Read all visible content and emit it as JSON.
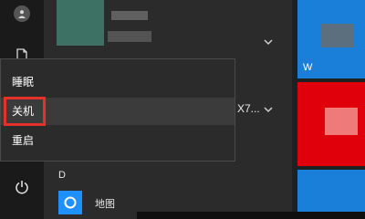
{
  "power_menu": {
    "items": [
      {
        "label": "睡眠"
      },
      {
        "label": "关机"
      },
      {
        "label": "重启"
      }
    ]
  },
  "app_list": {
    "partial_label": "X7...",
    "section_letter": "D",
    "maps_label": "地图"
  },
  "tiles": {
    "partial_label": "W"
  },
  "colors": {
    "highlight_box": "#e5312a",
    "tile_blue": "#1a7fd9",
    "tile_red": "#e0000c",
    "app_blue": "#1e90ff"
  }
}
